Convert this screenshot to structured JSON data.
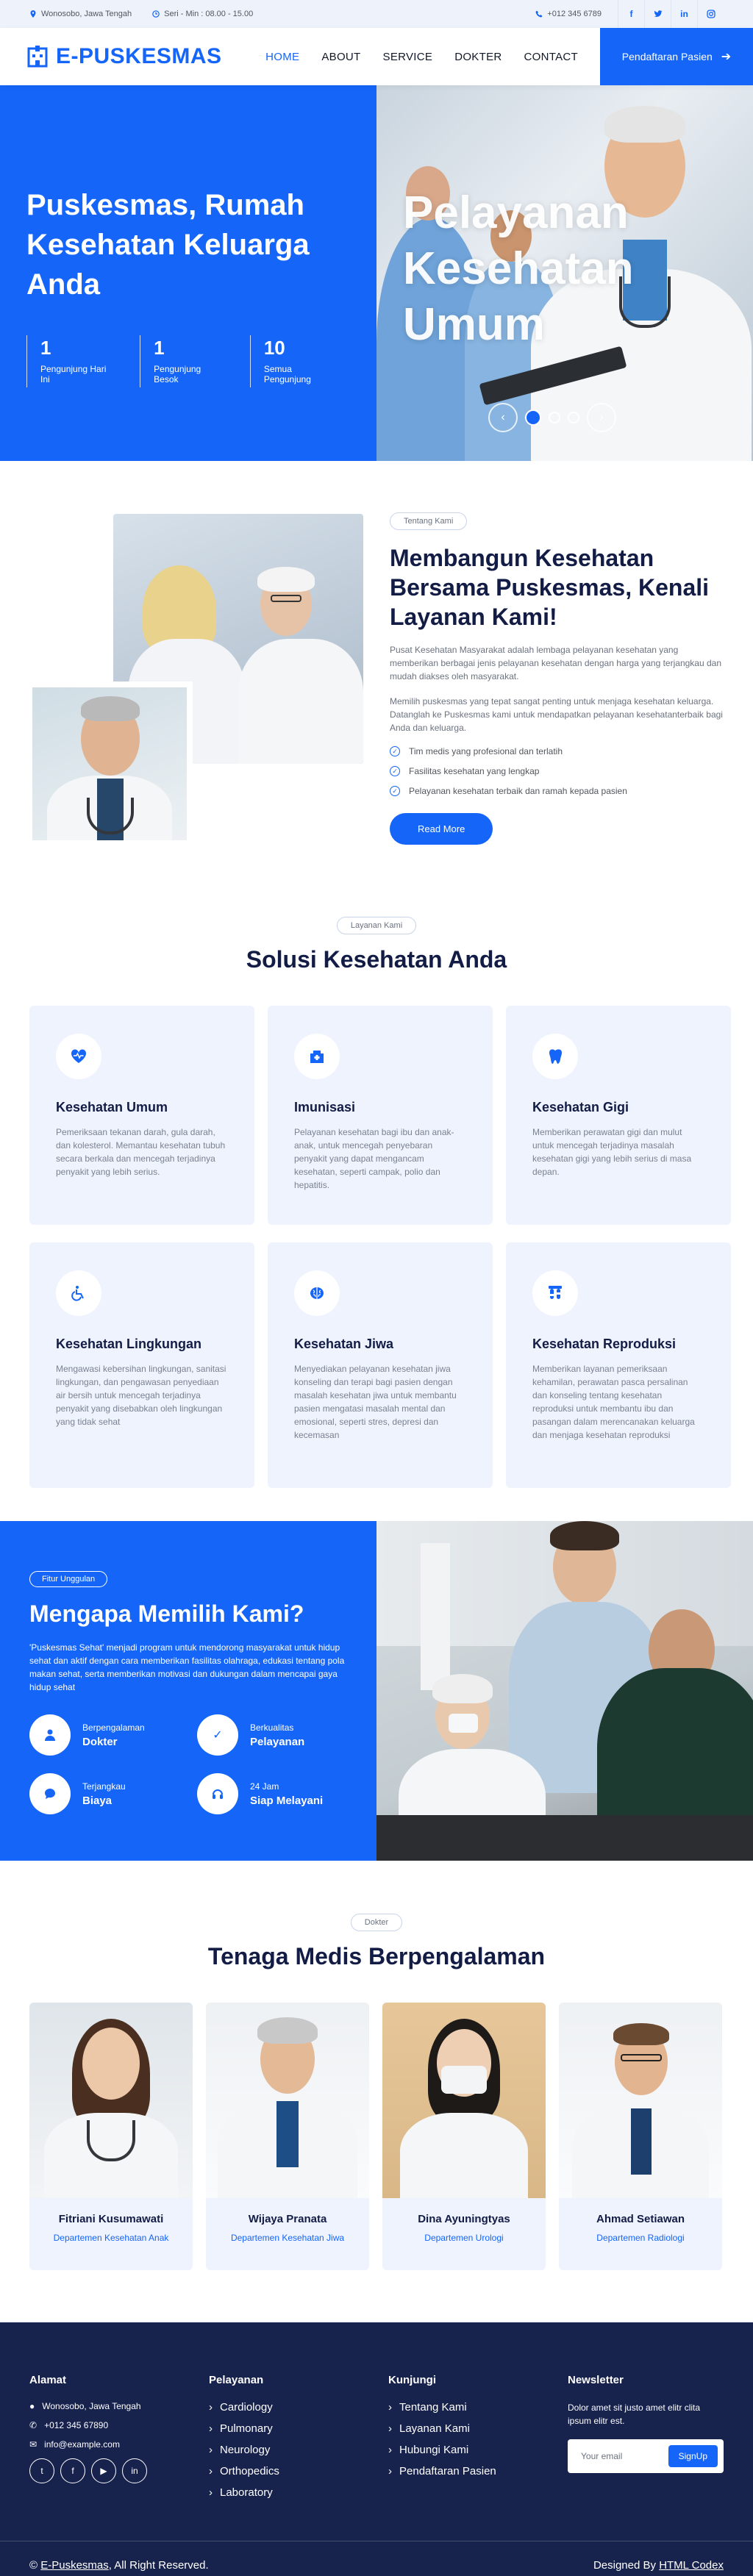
{
  "topbar": {
    "address": "Wonosobo, Jawa Tengah",
    "hours": "Seri - Min : 08.00 - 15.00",
    "phone": "+012 345 6789",
    "socials": [
      "f",
      "t",
      "in",
      "ig"
    ]
  },
  "navbar": {
    "brand": "E-PUSKESMAS",
    "menu": [
      "HOME",
      "ABOUT",
      "SERVICE",
      "DOKTER",
      "CONTACT"
    ],
    "cta": "Pendaftaran Pasien"
  },
  "hero": {
    "headline": "Puskesmas, Rumah Kesehatan Keluarga Anda",
    "stats": [
      {
        "num": "1",
        "label": "Pengunjung Hari Ini"
      },
      {
        "num": "1",
        "label": "Pengunjung Besok"
      },
      {
        "num": "10",
        "label": "Semua Pengunjung"
      }
    ],
    "slide_title": "Pelayanan Kesehatan Umum"
  },
  "about": {
    "pill": "Tentang Kami",
    "title": "Membangun Kesehatan Bersama Puskesmas, Kenali Layanan Kami!",
    "p1": "Pusat Kesehatan Masyarakat adalah lembaga pelayanan kesehatan yang memberikan berbagai jenis pelayanan kesehatan dengan harga yang terjangkau dan mudah diakses oleh masyarakat.",
    "p2": "Memilih puskesmas yang tepat sangat penting untuk menjaga kesehatan keluarga. Datanglah ke Puskesmas kami untuk mendapatkan pelayanan kesehatanterbaik bagi Anda dan keluarga.",
    "checks": [
      "Tim medis yang profesional dan terlatih",
      "Fasilitas kesehatan yang lengkap",
      "Pelayanan kesehatan terbaik dan ramah kepada pasien"
    ],
    "button": "Read More"
  },
  "services": {
    "pill": "Layanan Kami",
    "title": "Solusi Kesehatan Anda",
    "items": [
      {
        "title": "Kesehatan Umum",
        "desc": "Pemeriksaan tekanan darah, gula darah, dan kolesterol. Memantau kesehatan tubuh secara berkala dan mencegah terjadinya penyakit yang lebih serius.",
        "icon": "heart-icon"
      },
      {
        "title": "Imunisasi",
        "desc": "Pelayanan kesehatan bagi ibu dan anak-anak, untuk mencegah penyebaran penyakit yang dapat mengancam kesehatan, seperti campak, polio dan hepatitis.",
        "icon": "hospital-icon"
      },
      {
        "title": "Kesehatan Gigi",
        "desc": "Memberikan perawatan gigi dan mulut untuk mencegah terjadinya masalah kesehatan gigi yang lebih serius di masa depan.",
        "icon": "tooth-icon"
      },
      {
        "title": "Kesehatan Lingkungan",
        "desc": "Mengawasi kebersihan lingkungan, sanitasi lingkungan, dan pengawasan penyediaan air bersih untuk mencegah terjadinya penyakit yang disebabkan oleh lingkungan yang tidak sehat",
        "icon": "wheelchair-icon"
      },
      {
        "title": "Kesehatan Jiwa",
        "desc": "Menyediakan pelayanan kesehatan jiwa konseling dan terapi bagi pasien dengan masalah kesehatan jiwa untuk membantu pasien mengatasi masalah mental dan emosional, seperti stres, depresi dan kecemasan",
        "icon": "brain-icon"
      },
      {
        "title": "Kesehatan Reproduksi",
        "desc": "Memberikan layanan pemeriksaan kehamilan, perawatan pasca persalinan dan konseling tentang kesehatan reproduksi untuk membantu ibu dan pasangan dalam merencanakan keluarga dan menjaga kesehatan reproduksi",
        "icon": "vial-icon"
      }
    ]
  },
  "why": {
    "pill": "Fitur Unggulan",
    "title": "Mengapa Memilih Kami?",
    "desc": "'Puskesmas Sehat' menjadi program untuk mendorong masyarakat untuk hidup sehat dan aktif dengan cara memberikan fasilitas olahraga, edukasi tentang pola makan sehat, serta memberikan motivasi dan dukungan dalam mencapai gaya hidup sehat",
    "features": [
      {
        "t1": "Berpengalaman",
        "t2": "Dokter",
        "icon": "user-md-icon"
      },
      {
        "t1": "Berkualitas",
        "t2": "Pelayanan",
        "icon": "check-icon"
      },
      {
        "t1": "Terjangkau",
        "t2": "Biaya",
        "icon": "chat-icon"
      },
      {
        "t1": "24 Jam",
        "t2": "Siap Melayani",
        "icon": "headset-icon"
      }
    ]
  },
  "doctors": {
    "pill": "Dokter",
    "title": "Tenaga Medis Berpengalaman",
    "items": [
      {
        "name": "Fitriani Kusumawati",
        "dept": "Departemen Kesehatan Anak"
      },
      {
        "name": "Wijaya Pranata",
        "dept": "Departemen Kesehatan Jiwa"
      },
      {
        "name": "Dina Ayuningtyas",
        "dept": "Departemen Urologi"
      },
      {
        "name": "Ahmad Setiawan",
        "dept": "Departemen Radiologi"
      }
    ]
  },
  "footer": {
    "alamat_title": "Alamat",
    "address": "Wonosobo, Jawa Tengah",
    "phone": "+012 345 67890",
    "email": "info@example.com",
    "socials": [
      "t",
      "f",
      "yt",
      "in"
    ],
    "pelayanan_title": "Pelayanan",
    "pelayanan": [
      "Cardiology",
      "Pulmonary",
      "Neurology",
      "Orthopedics",
      "Laboratory"
    ],
    "kunjungi_title": "Kunjungi",
    "kunjungi": [
      "Tentang Kami",
      "Layanan Kami",
      "Hubungi Kami",
      "Pendaftaran Pasien"
    ],
    "newsletter_title": "Newsletter",
    "newsletter_desc": "Dolor amet sit justo amet elitr clita ipsum elitr est.",
    "email_placeholder": "Your email",
    "signup": "SignUp",
    "copyright_pre": "©",
    "copyright_link": "E-Puskesmas",
    "copyright_post": ", All Right Reserved.",
    "designed_pre": "Designed By",
    "designed_link": "HTML Codex"
  },
  "colors": {
    "primary": "#1565f8",
    "dark": "#121c45",
    "footer": "#17224d",
    "card": "#eef3fe"
  }
}
